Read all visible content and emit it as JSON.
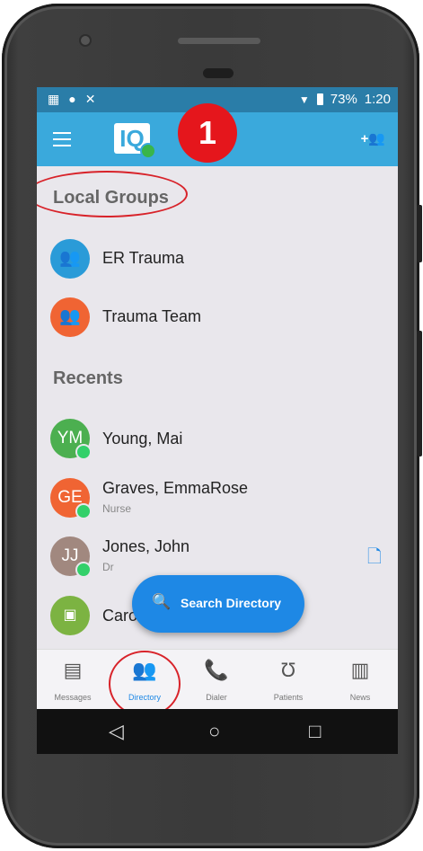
{
  "status_bar": {
    "battery": "73%",
    "time": "1:20"
  },
  "app_bar": {
    "logo_text": "IQ",
    "step_badge": "1"
  },
  "local_groups": {
    "title": "Local Groups",
    "items": [
      {
        "name": "ER Trauma",
        "color": "#2a9bd8"
      },
      {
        "name": "Trauma Team",
        "color": "#f06433"
      }
    ]
  },
  "recents": {
    "title": "Recents",
    "items": [
      {
        "initials": "YM",
        "name": "Young, Mai",
        "subtitle": "",
        "color": "#4caf50"
      },
      {
        "initials": "GE",
        "name": "Graves, EmmaRose",
        "subtitle": "Nurse",
        "color": "#f06433"
      },
      {
        "initials": "JJ",
        "name": "Jones, John",
        "subtitle": "Dr",
        "color": "#a1887f"
      },
      {
        "initials": "",
        "name": "Caro",
        "subtitle": "",
        "color": "#7cb342"
      }
    ]
  },
  "search_button": {
    "label": "Search Directory"
  },
  "bottom_nav": [
    {
      "label": "Messages",
      "icon": "message-icon"
    },
    {
      "label": "Directory",
      "icon": "people-icon"
    },
    {
      "label": "Dialer",
      "icon": "phone-icon"
    },
    {
      "label": "Patients",
      "icon": "stethoscope-icon"
    },
    {
      "label": "News",
      "icon": "news-icon"
    }
  ],
  "colors": {
    "app_bar": "#3aa9dc",
    "status_bar": "#2a7da8",
    "accent": "#1e88e5",
    "highlight": "#d8232a"
  }
}
